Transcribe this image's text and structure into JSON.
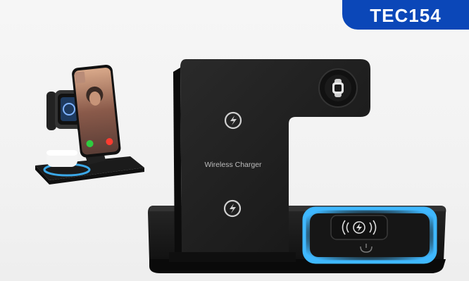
{
  "brand": {
    "badge_text": "TEC154",
    "badge_color": "#0b47b8"
  },
  "product": {
    "printed_label": "Wireless Charger",
    "accent_glow": "#3fb8ff",
    "body_color": "#1c1c1c"
  },
  "icons": [
    "watch-icon",
    "charging-icon",
    "wireless-charging-icon",
    "power-button-icon"
  ]
}
